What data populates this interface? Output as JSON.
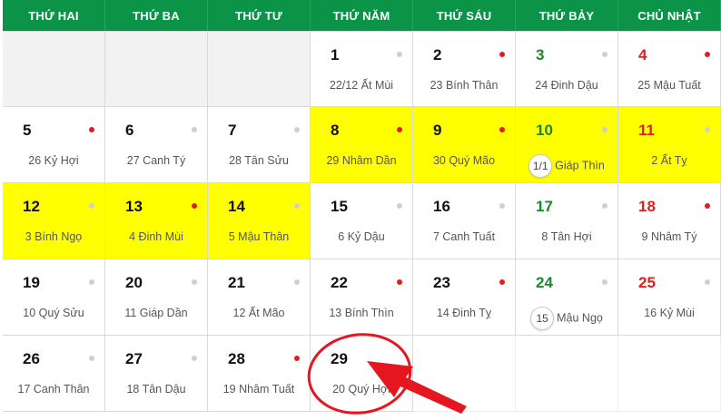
{
  "headers": [
    "THỨ HAI",
    "THỨ BA",
    "THỨ TƯ",
    "THỨ NĂM",
    "THỨ SÁU",
    "THỨ BẢY",
    "CHỦ NHẬT"
  ],
  "colors": {
    "header_bg": "#0b9348",
    "highlight": "#ffff00",
    "saturday": "#1a8a2a",
    "sunday": "#e01d1d",
    "annotation": "#e5161f"
  },
  "weeks": [
    [
      {
        "empty": true
      },
      {
        "empty": true
      },
      {
        "empty": true
      },
      {
        "day": "1",
        "lunar": "22/12 Ất Mùi",
        "dot": "grey"
      },
      {
        "day": "2",
        "lunar": "23 Bính Thân",
        "dot": "red"
      },
      {
        "day": "3",
        "lunar": "24 Đinh Dậu",
        "dot": "grey"
      },
      {
        "day": "4",
        "lunar": "25 Mậu Tuất",
        "dot": "red"
      }
    ],
    [
      {
        "day": "5",
        "lunar": "26 Kỷ Hợi",
        "dot": "red"
      },
      {
        "day": "6",
        "lunar": "27 Canh Tý",
        "dot": "grey"
      },
      {
        "day": "7",
        "lunar": "28 Tân Sửu",
        "dot": "grey"
      },
      {
        "day": "8",
        "lunar": "29 Nhâm Dần",
        "dot": "red",
        "highlight": true
      },
      {
        "day": "9",
        "lunar": "30 Quý Mão",
        "dot": "red",
        "highlight": true
      },
      {
        "day": "10",
        "lunar_ring": "1/1",
        "lunar": "Giáp Thìn",
        "dot": "grey",
        "highlight": true
      },
      {
        "day": "11",
        "lunar": "2 Ất Tỵ",
        "dot": "grey",
        "highlight": true
      }
    ],
    [
      {
        "day": "12",
        "lunar": "3 Bính Ngọ",
        "dot": "grey",
        "highlight": true
      },
      {
        "day": "13",
        "lunar": "4 Đinh Mùi",
        "dot": "red",
        "highlight": true
      },
      {
        "day": "14",
        "lunar": "5 Mậu Thân",
        "dot": "grey",
        "highlight": true
      },
      {
        "day": "15",
        "lunar": "6 Kỷ Dậu",
        "dot": "grey"
      },
      {
        "day": "16",
        "lunar": "7 Canh Tuất",
        "dot": "grey"
      },
      {
        "day": "17",
        "lunar": "8 Tân Hợi",
        "dot": "grey"
      },
      {
        "day": "18",
        "lunar": "9 Nhâm Tý",
        "dot": "red"
      }
    ],
    [
      {
        "day": "19",
        "lunar": "10 Quý Sửu",
        "dot": "grey"
      },
      {
        "day": "20",
        "lunar": "11 Giáp Dần",
        "dot": "grey"
      },
      {
        "day": "21",
        "lunar": "12 Ất Mão",
        "dot": "grey"
      },
      {
        "day": "22",
        "lunar": "13 Bính Thìn",
        "dot": "red"
      },
      {
        "day": "23",
        "lunar": "14 Đinh Tỵ",
        "dot": "red"
      },
      {
        "day": "24",
        "lunar_ring": "15",
        "lunar": "Mậu Ngọ",
        "dot": "grey"
      },
      {
        "day": "25",
        "lunar": "16 Kỷ Mùi",
        "dot": "grey"
      }
    ],
    [
      {
        "day": "26",
        "lunar": "17 Canh Thân",
        "dot": "grey"
      },
      {
        "day": "27",
        "lunar": "18 Tân Dậu",
        "dot": "grey"
      },
      {
        "day": "28",
        "lunar": "19 Nhâm Tuất",
        "dot": "red"
      },
      {
        "day": "29",
        "lunar": "20 Quý Hợi",
        "dot": "none"
      },
      {
        "empty": true,
        "blank": true
      },
      {
        "empty": true,
        "blank": true
      },
      {
        "empty": true,
        "blank": true
      }
    ]
  ]
}
